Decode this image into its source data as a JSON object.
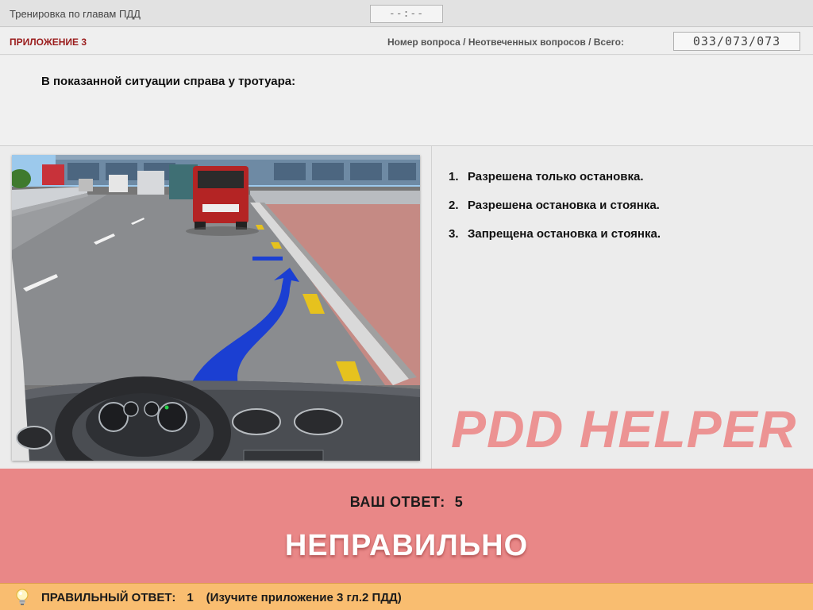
{
  "window": {
    "title": "Тренировка по главам ПДД",
    "timer": "--:--"
  },
  "infobar": {
    "appendix": "ПРИЛОЖЕНИЕ 3",
    "question_counter_label": "Номер вопроса / Неотвеченных вопросов / Всего:",
    "question_counter": "033/073/073"
  },
  "question": {
    "text": "В показанной ситуации справа у тротуара:"
  },
  "answers": [
    {
      "num": "1.",
      "text": "Разрешена только остановка."
    },
    {
      "num": "2.",
      "text": "Разрешена остановка и стоянка."
    },
    {
      "num": "3.",
      "text": "Запрещена остановка и стоянка."
    }
  ],
  "watermark": "PDD HELPER",
  "result": {
    "your_answer_label": "ВАШ ОТВЕТ:",
    "your_answer_value": "5",
    "verdict": "НЕПРАВИЛЬНО"
  },
  "footer": {
    "correct_label": "ПРАВИЛЬНЫЙ ОТВЕТ:",
    "correct_value": "1",
    "hint": "(Изучите приложение 3 гл.2 ПДД)"
  },
  "icons": {
    "hint": "lightbulb-icon"
  },
  "colors": {
    "result_bg": "#e98787",
    "footer_bg": "#f9bd70",
    "appendix_text": "#9a1c1c",
    "watermark": "#ec8a8a"
  }
}
